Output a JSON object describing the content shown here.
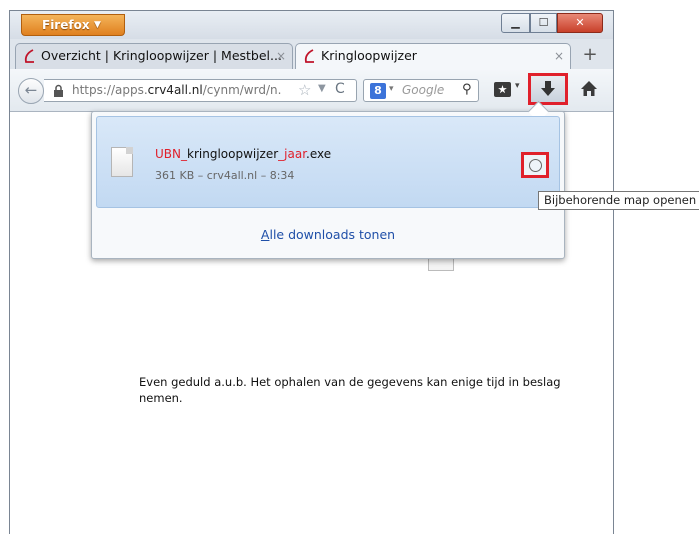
{
  "window": {
    "firefox_button": "Firefox",
    "controls": {
      "minimize": "▁",
      "maximize": "☐",
      "close": "✕"
    }
  },
  "tabs": [
    {
      "label": "Overzicht | Kringloopwijzer | Mestbel...",
      "close": "×"
    },
    {
      "label": "Kringloopwijzer",
      "close": "×"
    }
  ],
  "new_tab": "+",
  "navbar": {
    "back": "←",
    "url_prefix": "https://apps.",
    "url_domain": "crv4all.nl",
    "url_suffix": "/cynm/wrd/n.",
    "star": "☆",
    "dropdown": "▼",
    "reload": "C",
    "search_engine": "8",
    "search_dropdown": "▾",
    "search_placeholder": "Google",
    "search_go": "⚲",
    "bookmarks_dropdown": "▾"
  },
  "download_panel": {
    "item": {
      "name_part1": "UBN",
      "name_sep1": "_",
      "name_part2": "kringloopwijzer",
      "name_sep2": "_",
      "name_part3": "jaar",
      "name_ext": ".exe",
      "meta": "361 KB – crv4all.nl – 8:34"
    },
    "show_all_accel": "A",
    "show_all_rest": "lle downloads tonen"
  },
  "tooltip": "Bijbehorende map openen",
  "page": {
    "loading_text": "Even geduld a.u.b. Het ophalen van de gegevens kan enige tijd in beslag nemen."
  }
}
